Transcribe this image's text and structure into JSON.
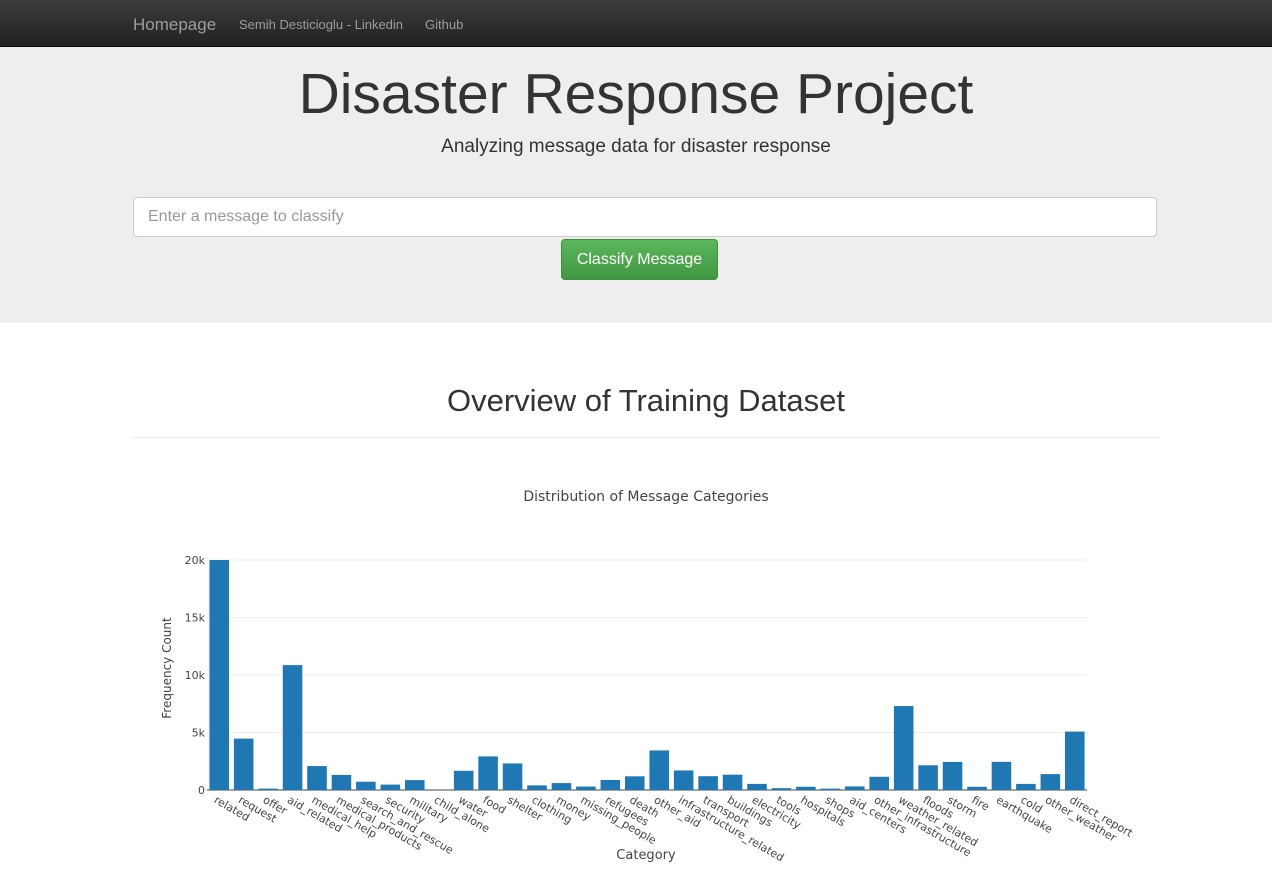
{
  "nav": {
    "brand": "Homepage",
    "links": [
      "Semih Desticioglu - Linkedin",
      "Github"
    ]
  },
  "jumbotron": {
    "title": "Disaster Response Project",
    "subtitle": "Analyzing message data for disaster response",
    "input_placeholder": "Enter a message to classify",
    "button_label": "Classify Message"
  },
  "section": {
    "title": "Overview of Training Dataset"
  },
  "colors": {
    "bar": "#1f77b4",
    "button": "#5cb85c",
    "navbar": "#222222",
    "jumbotron": "#eeeeee"
  },
  "chart_data": {
    "type": "bar",
    "title": "Distribution of Message Categories",
    "xlabel": "Category",
    "ylabel": "Frequency Count",
    "ylim": [
      0,
      20000
    ],
    "yticks": [
      0,
      5000,
      10000,
      15000,
      20000
    ],
    "ytick_labels": [
      "0",
      "5k",
      "10k",
      "15k",
      "20k"
    ],
    "grid": true,
    "categories": [
      "related",
      "request",
      "offer",
      "aid_related",
      "medical_help",
      "medical_products",
      "search_and_rescue",
      "security",
      "military",
      "child_alone",
      "water",
      "food",
      "shelter",
      "clothing",
      "money",
      "missing_people",
      "refugees",
      "death",
      "other_aid",
      "infrastructure_related",
      "transport",
      "buildings",
      "electricity",
      "tools",
      "hospitals",
      "shops",
      "aid_centers",
      "other_infrastructure",
      "weather_related",
      "floods",
      "storm",
      "fire",
      "earthquake",
      "cold",
      "other_weather",
      "direct_report"
    ],
    "values": [
      20000,
      4470,
      120,
      10860,
      2080,
      1310,
      720,
      470,
      860,
      0,
      1670,
      2920,
      2310,
      400,
      600,
      300,
      870,
      1190,
      3440,
      1700,
      1200,
      1330,
      530,
      160,
      280,
      120,
      310,
      1150,
      7300,
      2150,
      2440,
      280,
      2450,
      530,
      1380,
      5080
    ]
  }
}
